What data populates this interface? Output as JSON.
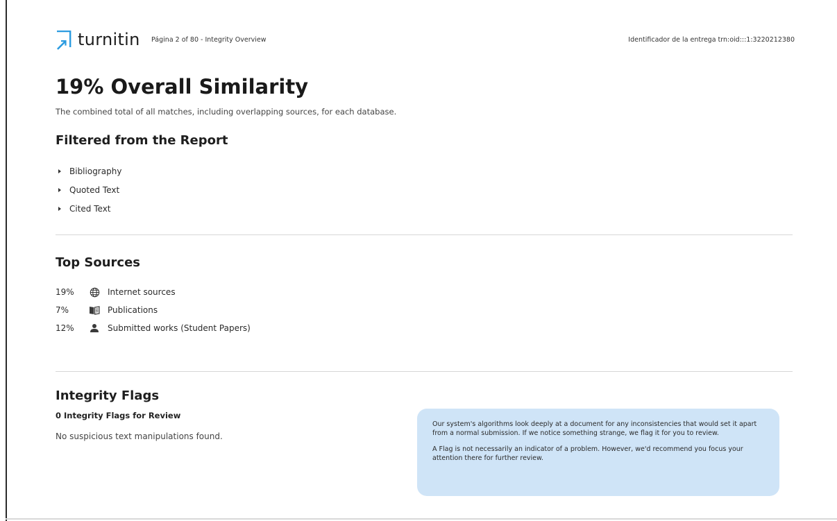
{
  "header": {
    "logo_text": "turnitin",
    "page_info": "Página 2 of 80 - Integrity Overview",
    "submission_id": "Identificador de la entrega trn:oid:::1:3220212380",
    "logo_color": "#2b9be0"
  },
  "title": "19% Overall Similarity",
  "subtitle": "The combined total of all matches, including overlapping sources, for each database.",
  "filtered": {
    "heading": "Filtered from the Report",
    "items": [
      {
        "label": "Bibliography",
        "icon": "caret-right-icon"
      },
      {
        "label": "Quoted Text",
        "icon": "caret-right-icon"
      },
      {
        "label": "Cited Text",
        "icon": "caret-right-icon"
      }
    ]
  },
  "top_sources": {
    "heading": "Top Sources",
    "rows": [
      {
        "percent": "19%",
        "icon": "globe-icon",
        "label": "Internet sources"
      },
      {
        "percent": "7%",
        "icon": "book-icon",
        "label": "Publications"
      },
      {
        "percent": "12%",
        "icon": "person-icon",
        "label": "Submitted works (Student Papers)"
      }
    ]
  },
  "integrity_flags": {
    "heading": "Integrity Flags",
    "count_label": "0 Integrity Flags for Review",
    "status_text": "No suspicious text manipulations found.",
    "info_paragraph_1": "Our system's algorithms look deeply at a document for any inconsistencies that would set it apart from a normal submission. If we notice something strange, we flag it for you to review.",
    "info_paragraph_2": "A Flag is not necessarily an indicator of a problem. However, we'd recommend you focus your attention there for further review.",
    "info_box_color": "#cfe4f7"
  }
}
